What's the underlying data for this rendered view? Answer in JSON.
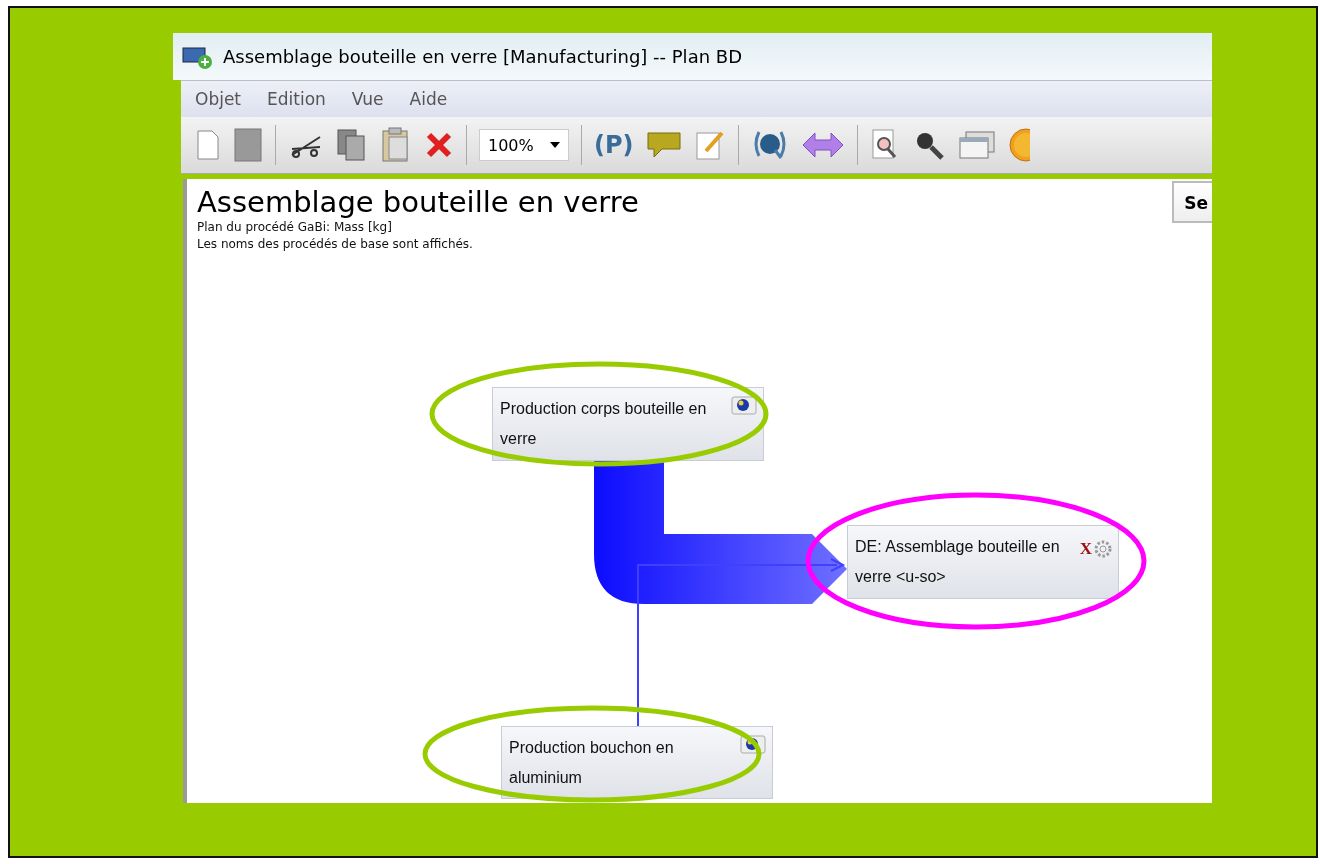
{
  "window": {
    "title": "Assemblage bouteille en verre [Manufacturing] -- Plan BD"
  },
  "menu": [
    "Objet",
    "Edition",
    "Vue",
    "Aide"
  ],
  "toolbar": {
    "zoom": "100%",
    "parameter_button": "(P)"
  },
  "plan": {
    "title": "Assemblage bouteille en verre",
    "subtitle": "Plan du procédé GaBi: Mass [kg]",
    "note": "Les noms des procédés de base sont affichés.",
    "side_button": "Se"
  },
  "nodes": [
    {
      "kind": "plan",
      "label": "Production corps bouteille en verre",
      "color": "#99cc00"
    },
    {
      "kind": "process",
      "label": "DE: Assemblage bouteille en verre <u-so>",
      "color": "#ff00ff",
      "badge": "X"
    },
    {
      "kind": "plan",
      "label": "Production bouchon en aluminium",
      "color": "#99cc00"
    }
  ]
}
